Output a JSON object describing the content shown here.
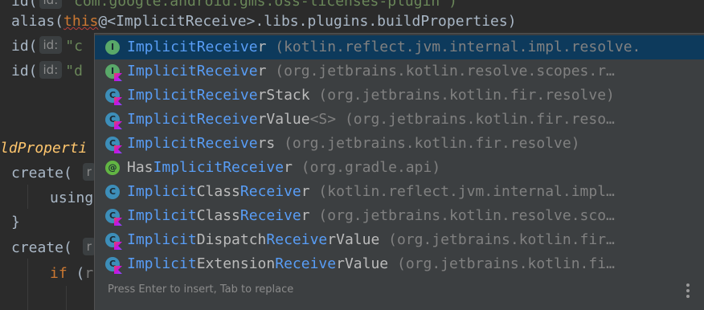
{
  "editor": {
    "line0": {
      "prefix": "id(",
      "hint": "id:",
      "string": "\"com.google.android.gms.oss-licenses-plugin\")"
    },
    "line1": {
      "a": "alias(",
      "this": "this",
      "b": "@<ImplicitReceive>.libs.plugins.buildProperties)"
    },
    "line2": {
      "prefix": "id(",
      "hint": "id:",
      "string": "\"c"
    },
    "line3": {
      "prefix": "id(",
      "hint": "id:",
      "string": "\"d"
    },
    "line5": {
      "fn": "ldProperti"
    },
    "line6": {
      "text": "create(",
      "tail": "r"
    },
    "line7": {
      "text": "using"
    },
    "line8": {
      "text": "}"
    },
    "line9": {
      "text": "create(",
      "tail": "r"
    },
    "line10": {
      "kw": "if",
      "text": "(",
      "tail": "r"
    }
  },
  "popup": {
    "items": [
      {
        "icon": "class-icon",
        "icon_color": "#59a869",
        "letter": "I",
        "kotlin": false,
        "pre": "",
        "m1": "ImplicitReceive",
        "mid": "r",
        "m2": "",
        "rest": "",
        "type": "",
        "pkg": " (kotlin.reflect.jvm.internal.impl.resolve.",
        "selected": true
      },
      {
        "icon": "kotlin-interface-icon",
        "icon_color": "#59a869",
        "letter": "I",
        "kotlin": true,
        "pre": "",
        "m1": "ImplicitReceive",
        "mid": "r",
        "m2": "",
        "rest": "",
        "type": "",
        "pkg": " (org.jetbrains.kotlin.resolve.scopes.r…"
      },
      {
        "icon": "kotlin-class-icon",
        "icon_color": "#3d8eb9",
        "letter": "C",
        "kotlin": true,
        "pre": "",
        "m1": "ImplicitReceive",
        "mid": "rStack",
        "m2": "",
        "rest": "",
        "type": "",
        "pkg": " (org.jetbrains.kotlin.fir.resolve)"
      },
      {
        "icon": "kotlin-class-icon",
        "icon_color": "#3d8eb9",
        "letter": "C",
        "kotlin": true,
        "pre": "",
        "m1": "ImplicitReceive",
        "mid": "rValue",
        "m2": "",
        "rest": "",
        "type": "<S>",
        "pkg": " (org.jetbrains.kotlin.fir.reso…"
      },
      {
        "icon": "kotlin-class-icon",
        "icon_color": "#3d8eb9",
        "letter": "C",
        "kotlin": true,
        "pre": "",
        "m1": "ImplicitReceive",
        "mid": "rs",
        "m2": "",
        "rest": "",
        "type": "",
        "pkg": " (org.jetbrains.kotlin.fir.resolve)"
      },
      {
        "icon": "annotation-icon",
        "icon_color": "#62b543",
        "letter": "@",
        "kotlin": false,
        "pre": "Has",
        "m1": "ImplicitReceive",
        "mid": "r",
        "m2": "",
        "rest": "",
        "type": "",
        "pkg": " (org.gradle.api)"
      },
      {
        "icon": "class-icon",
        "icon_color": "#3d8eb9",
        "letter": "C",
        "kotlin": false,
        "pre": "",
        "m1": "Implicit",
        "mid": "Class",
        "m2": "Receive",
        "rest": "r",
        "type": "",
        "pkg": " (kotlin.reflect.jvm.internal.impl…"
      },
      {
        "icon": "kotlin-class-icon",
        "icon_color": "#3d8eb9",
        "letter": "C",
        "kotlin": true,
        "pre": "",
        "m1": "Implicit",
        "mid": "Class",
        "m2": "Receive",
        "rest": "r",
        "type": "",
        "pkg": " (org.jetbrains.kotlin.resolve.sco…"
      },
      {
        "icon": "kotlin-class-icon",
        "icon_color": "#3d8eb9",
        "letter": "C",
        "kotlin": true,
        "pre": "",
        "m1": "Implicit",
        "mid": "Dispatch",
        "m2": "Receive",
        "rest": "rValue",
        "type": "",
        "pkg": " (org.jetbrains.kotlin.fir…"
      },
      {
        "icon": "kotlin-class-icon",
        "icon_color": "#3d8eb9",
        "letter": "C",
        "kotlin": true,
        "pre": "",
        "m1": "Implicit",
        "mid": "Extension",
        "m2": "Receive",
        "rest": "rValue",
        "type": "",
        "pkg": " (org.jetbrains.kotlin.fi…"
      }
    ],
    "footer": "Press Enter to insert, Tab to replace",
    "more_icon": "more-vertical-icon"
  }
}
